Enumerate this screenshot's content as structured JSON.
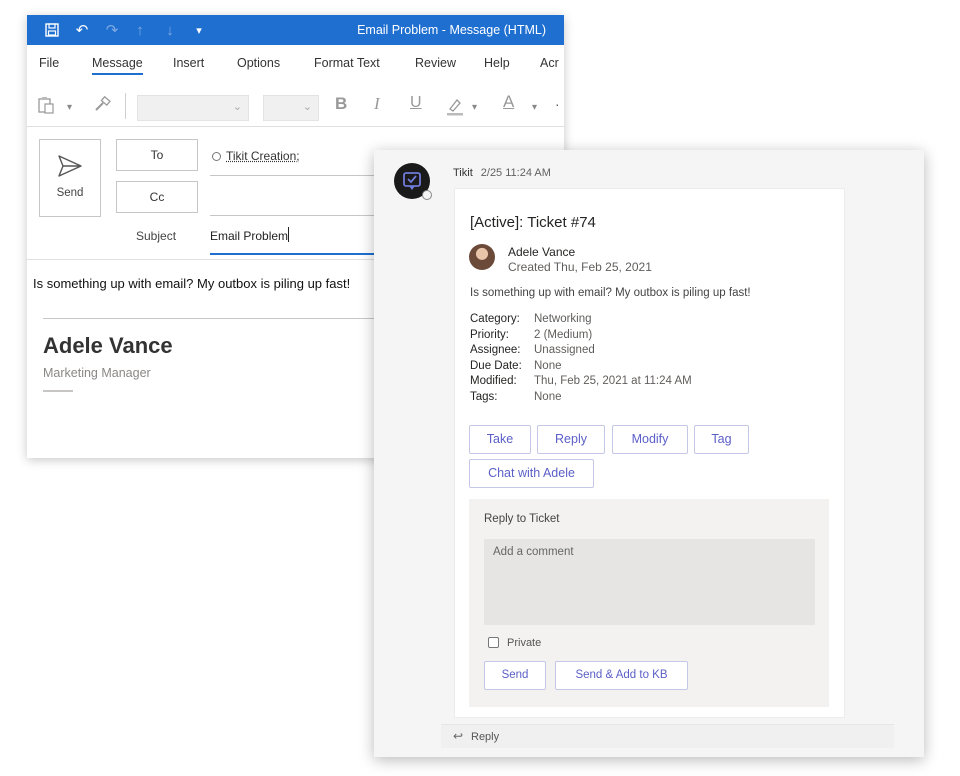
{
  "outlook": {
    "window_title": "Email Problem  -  Message (HTML)",
    "quick_access": [
      "save-icon",
      "undo-icon",
      "redo-icon",
      "up-arrow-icon",
      "down-arrow-icon",
      "customize-icon"
    ],
    "menu": [
      "File",
      "Message",
      "Insert",
      "Options",
      "Format Text",
      "Review",
      "Help",
      "Acr"
    ],
    "active_menu": "Message",
    "ribbon": {
      "bold": "B",
      "italic": "I",
      "underline": "U",
      "font_color": "A"
    },
    "send_label": "Send",
    "to_label": "To",
    "cc_label": "Cc",
    "to_recipient": "Tikit Creation;",
    "subject_label": "Subject",
    "subject_value": "Email Problem",
    "body_text": "Is something up with email? My outbox is piling up fast!",
    "signature": {
      "name": "Adele Vance",
      "title": "Marketing Manager"
    }
  },
  "teams": {
    "sender": "Tikit",
    "timestamp": "2/25 11:24 AM",
    "card": {
      "title": "[Active]: Ticket #74",
      "requester_name": "Adele Vance",
      "created": "Created Thu, Feb 25, 2021",
      "description": "Is something up with email? My outbox is piling up fast!",
      "facts": [
        {
          "key": "Category:",
          "value": "Networking"
        },
        {
          "key": "Priority:",
          "value": "2 (Medium)"
        },
        {
          "key": "Assignee:",
          "value": "Unassigned"
        },
        {
          "key": "Due Date:",
          "value": "None"
        },
        {
          "key": "Modified:",
          "value": "Thu, Feb 25, 2021 at 11:24 AM"
        },
        {
          "key": "Tags:",
          "value": "None"
        }
      ],
      "actions": [
        "Take",
        "Reply",
        "Modify",
        "Tag"
      ],
      "chat_action": "Chat with Adele",
      "reply_section": {
        "title": "Reply to Ticket",
        "comment_placeholder": "Add a comment",
        "private_label": "Private",
        "send_label": "Send",
        "send_kb_label": "Send & Add to KB"
      }
    },
    "reply_bar_label": "Reply"
  },
  "colors": {
    "outlook_blue": "#1f6fd0",
    "teams_accent": "#5b5fc7"
  }
}
